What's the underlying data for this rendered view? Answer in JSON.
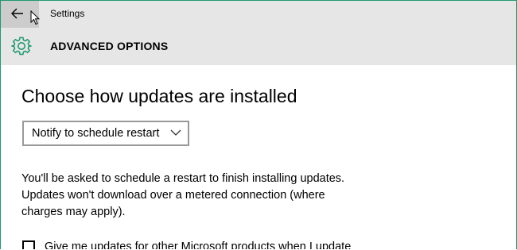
{
  "window": {
    "app_title": "Settings",
    "accent_color": "#1f9a6f"
  },
  "header": {
    "icon": "gear-icon",
    "title": "ADVANCED OPTIONS"
  },
  "main": {
    "heading": "Choose how updates are installed",
    "install_mode": {
      "selected": "Notify to schedule restart"
    },
    "description_lines": [
      "You'll be asked to schedule a restart to finish installing updates.",
      "Updates won't download over a metered connection (where",
      "charges may apply)."
    ],
    "ms_products_checkbox": {
      "label": "Give me updates for other Microsoft products when I update",
      "checked": false
    }
  }
}
